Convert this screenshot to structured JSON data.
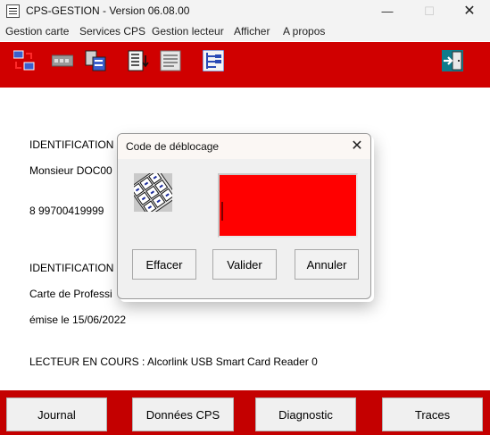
{
  "window": {
    "title": "CPS-GESTION - Version 06.08.00"
  },
  "menu": {
    "items": [
      "Gestion carte",
      "Services CPS",
      "Gestion lecteur",
      "Afficher",
      "A propos"
    ]
  },
  "toolbar": {
    "buttons": [
      "card-list-icon",
      "card-reader-icon",
      "card-swap-icon",
      "download-list-icon",
      "notes-icon",
      "tree-icon",
      "exit-door-icon"
    ]
  },
  "main": {
    "lines": [
      "IDENTIFICATION",
      "Monsieur DOC00",
      "8 99700419999",
      "IDENTIFICATION",
      "Carte de Professi",
      "émise le 15/06/2022",
      "LECTEUR EN COURS : Alcorlink USB Smart Card Reader 0"
    ]
  },
  "bottom": {
    "buttons": [
      "Journal",
      "Données CPS",
      "Diagnostic",
      "Traces"
    ]
  },
  "dialog": {
    "title": "Code de déblocage",
    "close": "✕",
    "field_color": "#ff0000",
    "buttons": {
      "clear": "Effacer",
      "validate": "Valider",
      "cancel": "Annuler"
    }
  },
  "colors": {
    "accent": "#d00000",
    "bottom": "#c40000"
  }
}
